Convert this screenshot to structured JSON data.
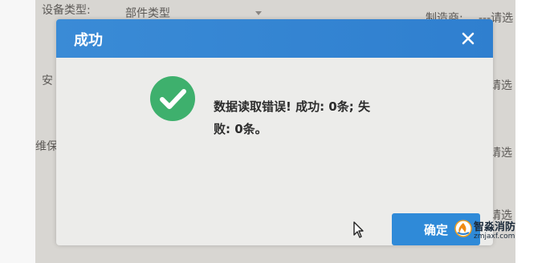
{
  "background_form": {
    "device_type_label": "设备类型:",
    "device_type_value": "部件类型",
    "manufacturer_label": "制造商:",
    "manufacturer_value": "---请选",
    "install_label": "安",
    "maintain_label": "维保",
    "select_right_1": "请选",
    "select_right_2": "请选",
    "select_right_3": "请选"
  },
  "dialog": {
    "title": "成功",
    "message_line1": "数据读取错误! 成功: 0条; 失",
    "message_line2": "败: 0条。",
    "confirm_label": "确定",
    "close_icon": "close-icon",
    "status_icon": "check-circle-icon",
    "header_color": "#3a8bd6",
    "icon_color": "#3eb06d"
  },
  "watermark": {
    "name": "智淼消防",
    "url": "zmjaxf.com"
  }
}
